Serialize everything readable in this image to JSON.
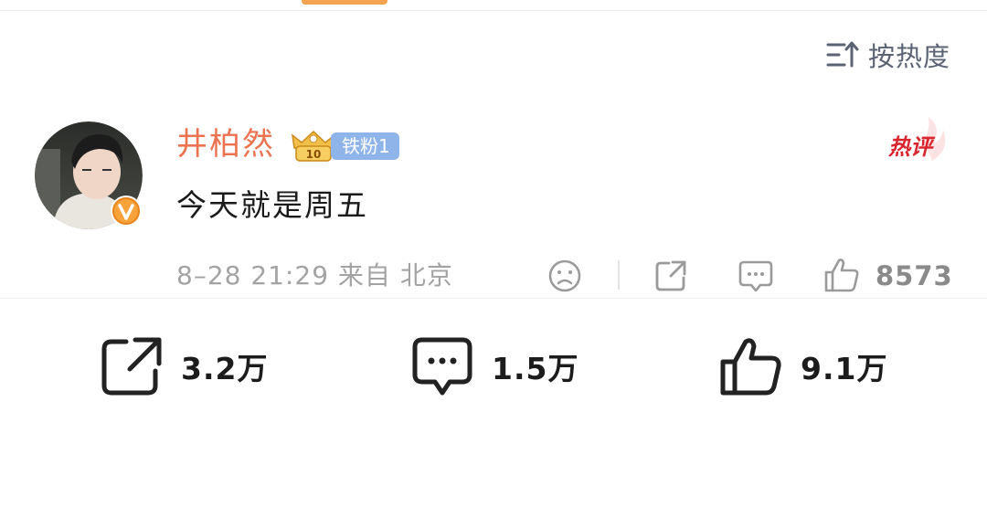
{
  "sort": {
    "label": "按热度",
    "icon": "sort-icon"
  },
  "comment": {
    "username": "井柏然",
    "fan_badge": {
      "label": "铁粉1",
      "level_icon_text": "10"
    },
    "hot_tag": "热评",
    "text": "今天就是周五",
    "meta": "8–28 21:29  来自 北京",
    "like_count": "8573"
  },
  "actions": {
    "share": {
      "count": "3.2万",
      "icon": "share-icon"
    },
    "comment": {
      "count": "1.5万",
      "icon": "comment-icon"
    },
    "like": {
      "count": "9.1万",
      "icon": "thumbs-up-icon"
    }
  },
  "colors": {
    "accent_orange": "#eb7350",
    "tab_indicator": "#f4a44e",
    "badge_blue": "#8fb4ea",
    "hot_red": "#d9252e"
  }
}
